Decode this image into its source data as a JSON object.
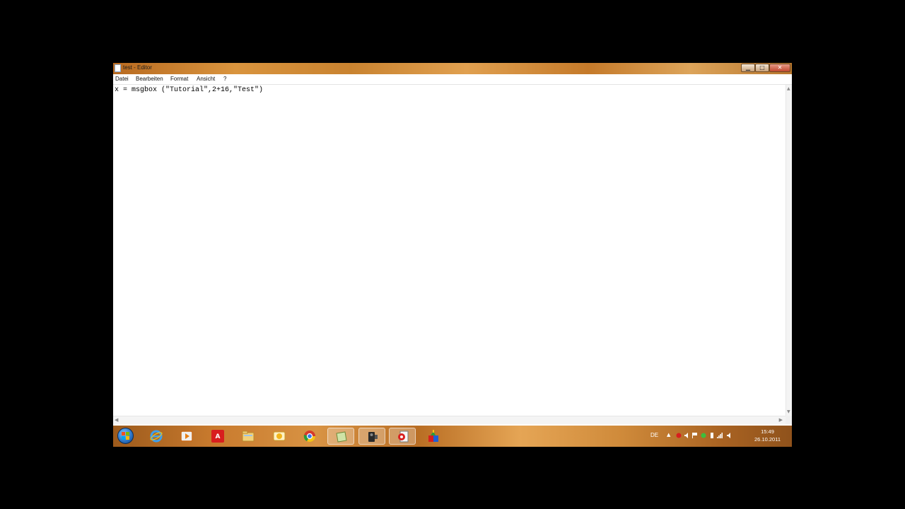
{
  "window": {
    "title": "test - Editor"
  },
  "menu": {
    "items": [
      {
        "label": "Datei"
      },
      {
        "label": "Bearbeiten"
      },
      {
        "label": "Format"
      },
      {
        "label": "Ansicht"
      },
      {
        "label": "?"
      }
    ]
  },
  "editor": {
    "content": "x = msgbox (\"Tutorial\",2+16,\"Test\")"
  },
  "taskbar": {
    "apps": [
      {
        "name": "internet-explorer-icon"
      },
      {
        "name": "media-player-icon"
      },
      {
        "name": "avira-icon"
      },
      {
        "name": "file-explorer-icon"
      },
      {
        "name": "messenger-icon"
      },
      {
        "name": "chrome-icon"
      },
      {
        "name": "notepad-folder-icon"
      },
      {
        "name": "camera-icon"
      },
      {
        "name": "editor-app-icon"
      },
      {
        "name": "paint-app-icon"
      }
    ],
    "tray": {
      "language": "DE",
      "time": "15:49",
      "date": "26.10.2011"
    }
  },
  "colors": {
    "accent": "#2f78c8",
    "avira": "#d81e1e",
    "chrome_green": "#2a9d3a",
    "chrome_yellow": "#f2c418",
    "chrome_red": "#d63a2b"
  }
}
